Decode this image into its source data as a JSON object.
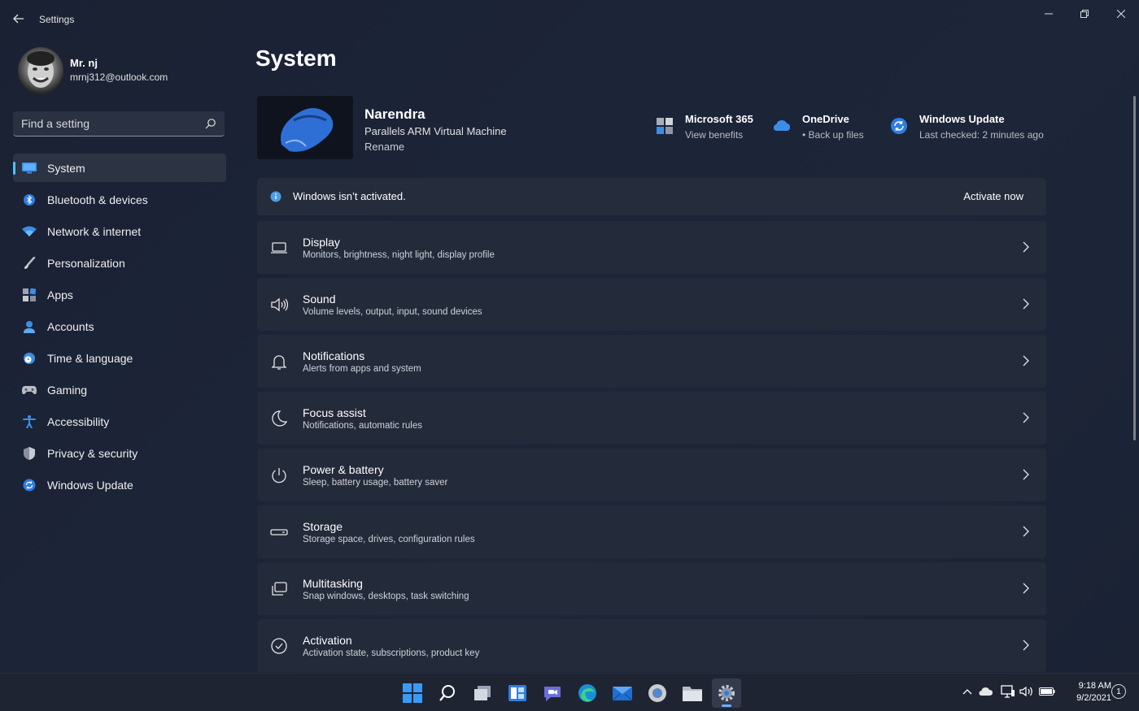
{
  "window": {
    "title": "Settings",
    "controls": [
      "minimize",
      "restore",
      "close"
    ]
  },
  "profile": {
    "name": "Mr. nj",
    "email": "mrnj312@outlook.com"
  },
  "search": {
    "placeholder": "Find a setting"
  },
  "sidebar": {
    "items": [
      {
        "label": "System",
        "icon": "monitor-icon",
        "active": true
      },
      {
        "label": "Bluetooth & devices",
        "icon": "bluetooth-icon"
      },
      {
        "label": "Network & internet",
        "icon": "wifi-icon"
      },
      {
        "label": "Personalization",
        "icon": "brush-icon"
      },
      {
        "label": "Apps",
        "icon": "apps-icon"
      },
      {
        "label": "Accounts",
        "icon": "person-icon"
      },
      {
        "label": "Time & language",
        "icon": "clock-globe-icon"
      },
      {
        "label": "Gaming",
        "icon": "gamepad-icon"
      },
      {
        "label": "Accessibility",
        "icon": "accessibility-icon"
      },
      {
        "label": "Privacy & security",
        "icon": "shield-icon"
      },
      {
        "label": "Windows Update",
        "icon": "update-icon"
      }
    ]
  },
  "main": {
    "title": "System",
    "device": {
      "name": "Narendra",
      "model": "Parallels ARM Virtual Machine",
      "rename": "Rename"
    },
    "quick": [
      {
        "title": "Microsoft 365",
        "sub": "View benefits",
        "icon": "microsoft365-icon"
      },
      {
        "title": "OneDrive",
        "sub": "• Back up files",
        "icon": "cloud-icon"
      },
      {
        "title": "Windows Update",
        "sub": "Last checked: 2 minutes ago",
        "icon": "update-icon"
      }
    ],
    "activation": {
      "text": "Windows isn’t activated.",
      "button": "Activate now"
    },
    "rows": [
      {
        "title": "Display",
        "sub": "Monitors, brightness, night light, display profile",
        "icon": "display-icon"
      },
      {
        "title": "Sound",
        "sub": "Volume levels, output, input, sound devices",
        "icon": "speaker-icon"
      },
      {
        "title": "Notifications",
        "sub": "Alerts from apps and system",
        "icon": "bell-icon"
      },
      {
        "title": "Focus assist",
        "sub": "Notifications, automatic rules",
        "icon": "moon-icon"
      },
      {
        "title": "Power & battery",
        "sub": "Sleep, battery usage, battery saver",
        "icon": "power-icon"
      },
      {
        "title": "Storage",
        "sub": "Storage space, drives, configuration rules",
        "icon": "storage-icon"
      },
      {
        "title": "Multitasking",
        "sub": "Snap windows, desktops, task switching",
        "icon": "multitasking-icon"
      },
      {
        "title": "Activation",
        "sub": "Activation state, subscriptions, product key",
        "icon": "check-circle-icon"
      }
    ]
  },
  "taskbar": {
    "apps": [
      "start-icon",
      "search-icon",
      "task-view-icon",
      "widgets-icon",
      "teams-chat-icon",
      "edge-icon",
      "mail-icon",
      "chrome-icon",
      "file-explorer-icon",
      "settings-gear-icon"
    ],
    "tray": [
      "chevron-up-icon",
      "onedrive-icon",
      "network-icon",
      "volume-icon",
      "battery-icon"
    ],
    "time": "9:18 AM",
    "date": "9/2/2021",
    "notifications": "1"
  },
  "colors": {
    "accent": "#4cc2ff",
    "background": "#1c2438",
    "card": "#232a3a"
  }
}
